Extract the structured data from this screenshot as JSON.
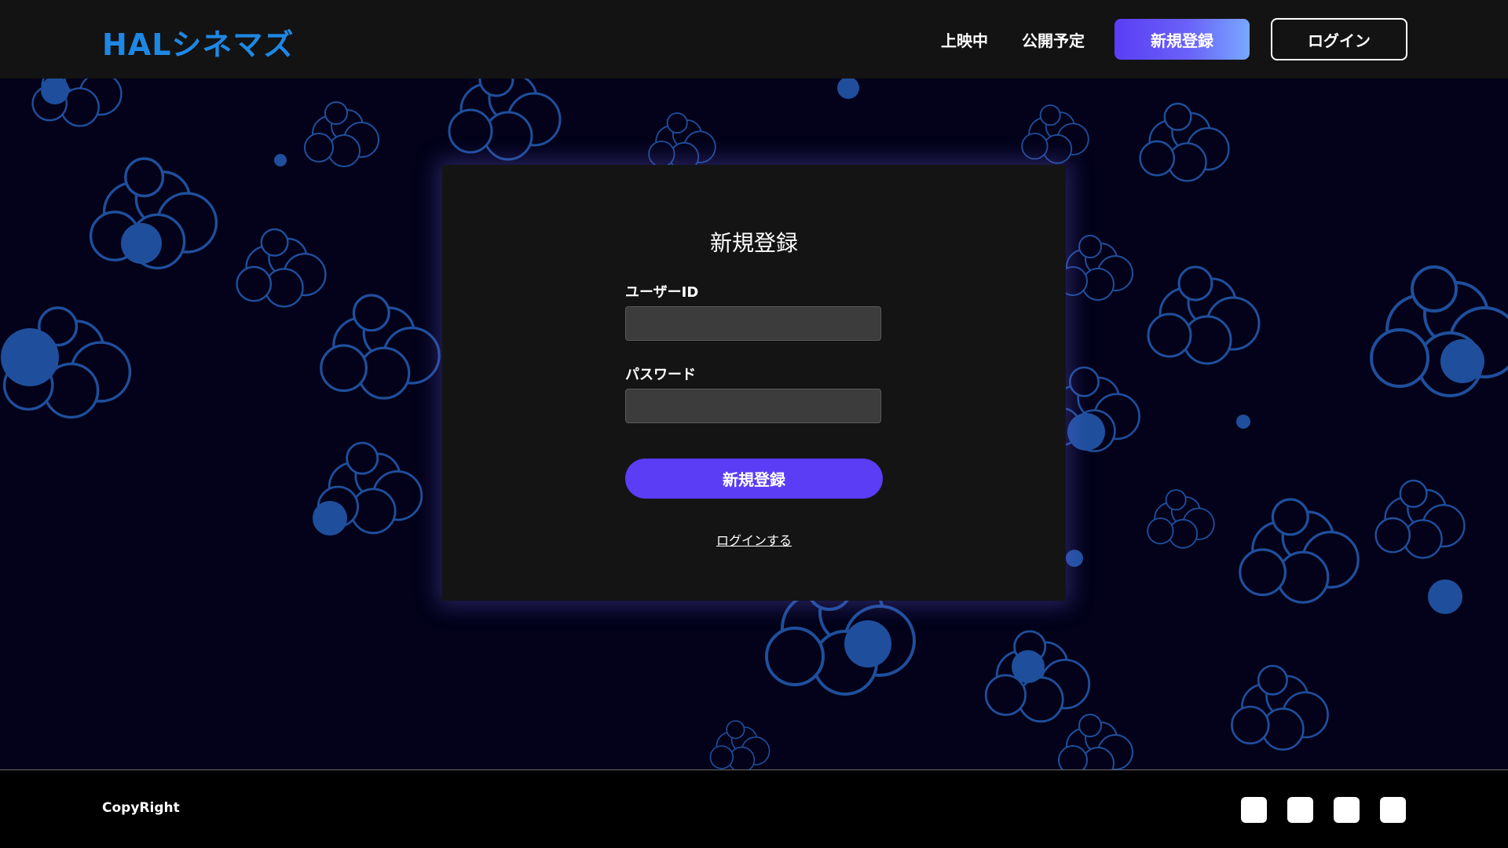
{
  "header": {
    "logo": "HALシネマズ",
    "nav": {
      "now_showing": "上映中",
      "coming_soon": "公開予定"
    },
    "register_label": "新規登録",
    "login_label": "ログイン"
  },
  "form": {
    "title": "新規登録",
    "user_id_label": "ユーザーID",
    "user_id_value": "",
    "password_label": "パスワード",
    "password_value": "",
    "submit_label": "新規登録",
    "login_link": "ログインする"
  },
  "footer": {
    "copyright": "CopyRight",
    "social_icons": [
      "social-icon-1",
      "social-icon-2",
      "social-icon-3",
      "social-icon-4"
    ]
  },
  "colors": {
    "background": "#03021a",
    "header_bg": "#131313",
    "card_bg": "#141414",
    "accent": "#5b3df5",
    "logo": "#1e88e5",
    "decor": "#1f4f9c"
  }
}
